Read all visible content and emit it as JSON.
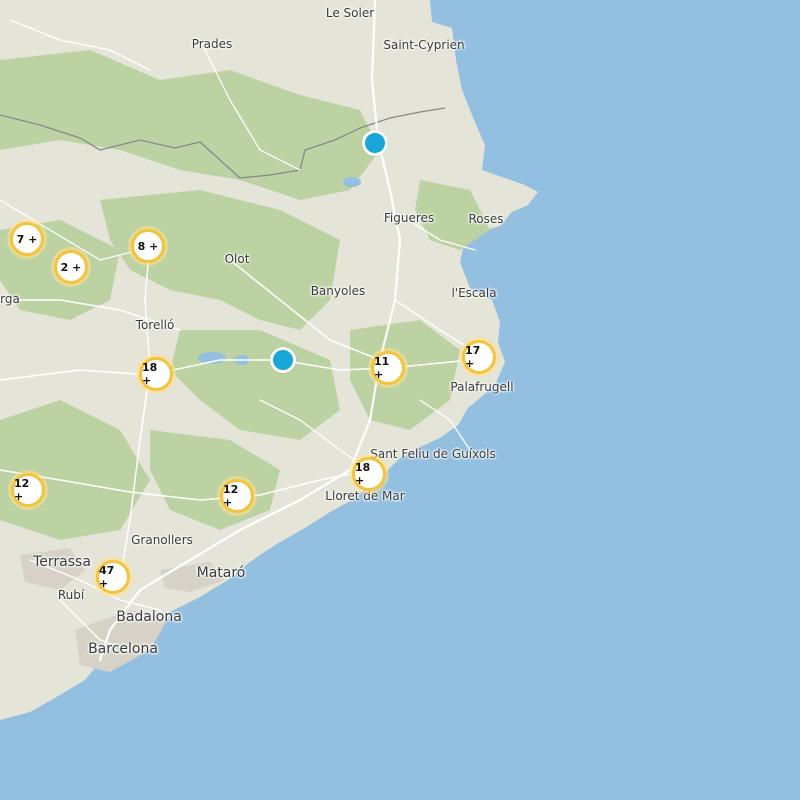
{
  "map": {
    "colors": {
      "sea": "#93bfe1",
      "land": "#e5e4d8",
      "forest": "#bcd2a3",
      "cluster_ring": "#f5c23d",
      "pin": "#18a7d8"
    },
    "places": [
      {
        "id": "le-soler",
        "name": "Le Soler"
      },
      {
        "id": "prades",
        "name": "Prades"
      },
      {
        "id": "saint-cyprien",
        "name": "Saint-Cyprien"
      },
      {
        "id": "figueres",
        "name": "Figueres"
      },
      {
        "id": "roses",
        "name": "Roses"
      },
      {
        "id": "olot",
        "name": "Olot"
      },
      {
        "id": "banyoles",
        "name": "Banyoles"
      },
      {
        "id": "lescala",
        "name": "l'Escala"
      },
      {
        "id": "rga",
        "name": "rga"
      },
      {
        "id": "torello",
        "name": "Torelló"
      },
      {
        "id": "palafrugell",
        "name": "Palafrugell"
      },
      {
        "id": "sant-feliu",
        "name": "Sant Feliu de Guíxols"
      },
      {
        "id": "lloret",
        "name": "Lloret de Mar"
      },
      {
        "id": "granollers",
        "name": "Granollers"
      },
      {
        "id": "terrassa",
        "name": "Terrassa"
      },
      {
        "id": "mataro",
        "name": "Mataró"
      },
      {
        "id": "rubi",
        "name": "Rubí"
      },
      {
        "id": "badalona",
        "name": "Badalona"
      },
      {
        "id": "barcelona",
        "name": "Barcelona"
      }
    ],
    "clusters": [
      {
        "id": "c1",
        "label": "7 +"
      },
      {
        "id": "c2",
        "label": "2 +"
      },
      {
        "id": "c3",
        "label": "8 +"
      },
      {
        "id": "c4",
        "label": "18 +"
      },
      {
        "id": "c5",
        "label": "11 +"
      },
      {
        "id": "c6",
        "label": "17 +"
      },
      {
        "id": "c7",
        "label": "18 +"
      },
      {
        "id": "c8",
        "label": "12 +"
      },
      {
        "id": "c9",
        "label": "12 +"
      },
      {
        "id": "c10",
        "label": "47 +"
      }
    ],
    "markers": [
      {
        "id": "m1"
      },
      {
        "id": "m2"
      }
    ]
  }
}
